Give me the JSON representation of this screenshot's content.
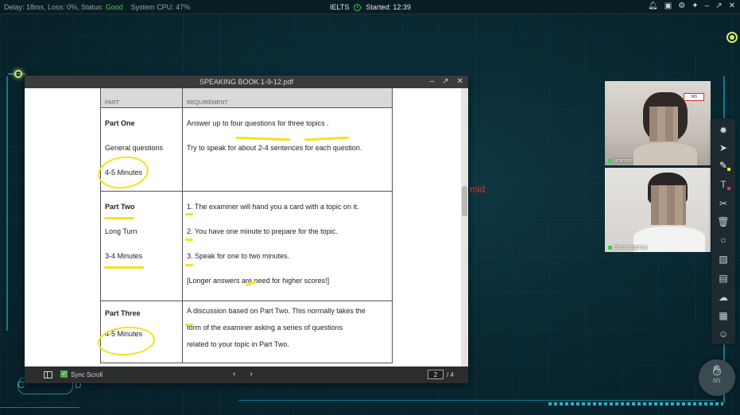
{
  "status": {
    "delay_label": "Delay: 18ms, Loss: 0%, Status:",
    "status_value": "Good",
    "cpu": "System CPU: 47%",
    "exam": "IELTS",
    "started": "Started: 12:39",
    "status_color": "#3fd24a"
  },
  "titlebar_icons": [
    "bell-icon",
    "screen-icon",
    "gear-icon",
    "pin-icon",
    "minimize-icon",
    "restore-icon",
    "close-icon"
  ],
  "pdf": {
    "title": "SPEAKING BOOK 1-9-12.pdf",
    "sync_label": "Sync Scroll",
    "page_current": "2",
    "page_total": "/ 4",
    "header_col1": "PART",
    "header_col2": "REQUIREMENT",
    "rows": [
      {
        "left": [
          "Part One",
          "General questions",
          "4-5 Minutes"
        ],
        "right": [
          "Answer up to four questions for three topics .",
          "Try to speak for about 2-4 sentences for each question."
        ]
      },
      {
        "left": [
          "Part Two",
          "Long Turn",
          "3-4 Minutes"
        ],
        "right": [
          "1. The examiner will hand you a card with a topic on it.",
          "2. You have one minute to prepare for the topic.",
          "3. Speak for one to two minutes.",
          "[Longer answers are need for higher scores!]"
        ]
      },
      {
        "left": [
          "Part Three",
          "4-5 Minutes"
        ],
        "right": [
          "A discussion based on Part Two. This normally takes the",
          "form of the examiner asking a series of questions",
          "related to your topic in Part Two."
        ]
      }
    ]
  },
  "videos": [
    {
      "name": "learner",
      "badge": "365"
    },
    {
      "name": "direct agency"
    }
  ],
  "stray_text": "mid",
  "hand": {
    "count": "0/1"
  },
  "bottom_left": {
    "c": "C",
    "d": "D"
  }
}
